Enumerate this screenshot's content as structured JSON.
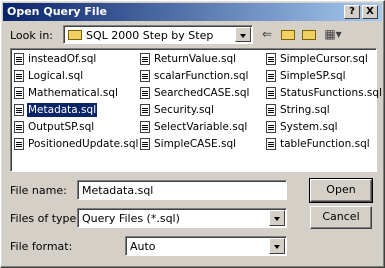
{
  "window": {
    "title": "Open Query File",
    "help_btn": "?",
    "close_btn": "X"
  },
  "lookin": {
    "label": "Look in:",
    "value": "SQL 2000 Step by Step",
    "tools": [
      "back-arrow-icon",
      "up-folder-icon",
      "new-folder-icon",
      "views-menu-icon"
    ]
  },
  "files": [
    [
      "insteadOf.sql",
      "ReturnValue.sql",
      "SimpleCursor.sql"
    ],
    [
      "Logical.sql",
      "scalarFunction.sql",
      "SimpleSP.sql"
    ],
    [
      "Mathematical.sql",
      "SearchedCASE.sql",
      "StatusFunctions.sql"
    ],
    [
      "Metadata.sql",
      "Security.sql",
      "String.sql"
    ],
    [
      "OutputSP.sql",
      "SelectVariable.sql",
      "System.sql"
    ],
    [
      "PositionedUpdate.sql",
      "SimpleCASE.sql",
      "tableFunction.sql"
    ]
  ],
  "selected_file": "Metadata.sql",
  "filename": {
    "label": "File name:",
    "value": "Metadata.sql"
  },
  "filetype": {
    "label": "Files of type:",
    "value": "Query Files (*.sql)"
  },
  "fileformat": {
    "label": "File format:",
    "value": "Auto"
  },
  "buttons": {
    "open": "Open",
    "cancel": "Cancel"
  }
}
